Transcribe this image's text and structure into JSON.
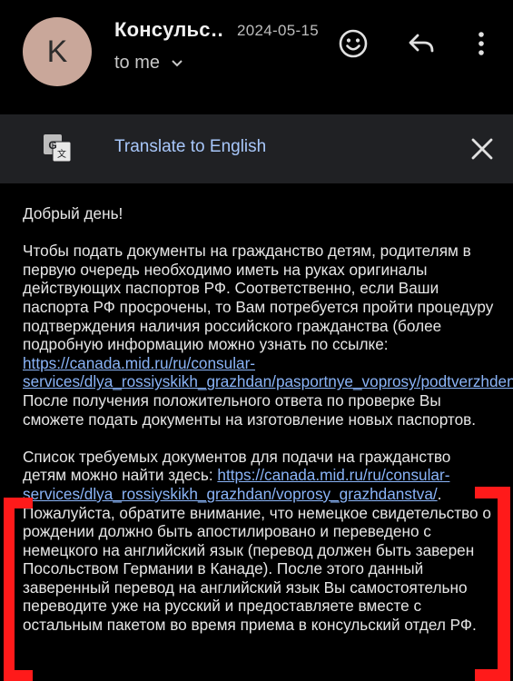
{
  "header": {
    "avatar_letter": "K",
    "sender": "Консульс…",
    "date": "2024-05-15",
    "to_label": "to me"
  },
  "translate": {
    "label": "Translate to English"
  },
  "body": {
    "greeting": "Добрый день!",
    "p1_text": "Чтобы подать документы на гражданство детям, родителям в первую очередь необходимо иметь на руках оригиналы действующих паспортов РФ. Соответственно, если Ваши паспорта РФ просрочены, то Вам потребуется пройти процедуру подтверждения наличия российского гражданства (более подробную информацию можно узнать по ссылке: ",
    "p1_link": "https://canada.mid.ru/ru/consular-services/dlya_rossiyskikh_grazhdan/pasportnye_voprosy/podtverzhdenie_nalichiya_grazhdanstva_rf/",
    "p1_after": ". После получения положительного ответа по проверке Вы сможете подать документы на изготовление новых паспортов.",
    "p2_text": "Список требуемых документов для подачи на гражданство детям можно найти здесь: ",
    "p2_link": "https://canada.mid.ru/ru/consular-services/dlya_rossiyskikh_grazhdan/voprosy_grazhdanstva/",
    "p2_after": ". Пожалуйста, обратите внимание, что немецкое свидетельство о рождении должно быть апостилировано и переведено с немецкого на английский язык (перевод должен быть заверен Посольством Германии в Канаде). После этого данный заверенный перевод на английский язык Вы самостоятельно переводите уже на русский и предоставляете вместе с остальным пакетом во время приема в консульский отдел РФ."
  },
  "colors": {
    "background": "#000000",
    "translate_bar": "#202124",
    "link": "#8ab4f8",
    "translate_text": "#a8c7fa",
    "avatar": "#c9a79a",
    "annotation_red": "#ff1a1a"
  },
  "icons": [
    "smiley-icon",
    "reply-icon",
    "more-vert-icon",
    "chevron-down-icon",
    "google-translate-icon",
    "close-icon"
  ]
}
